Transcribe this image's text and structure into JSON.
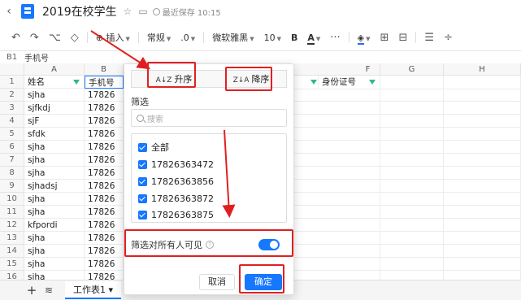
{
  "titlebar": {
    "back": "‹",
    "title": "2019在校学生",
    "star": "☆",
    "folder": "▭",
    "save_status": "最近保存 10:15"
  },
  "toolbar": {
    "undo": "↶",
    "redo": "↷",
    "format_painter": "⌥",
    "eraser": "◇",
    "insert": "插入",
    "number_format": "常规",
    "decimal": ".0",
    "font": "微软雅黑",
    "font_size": "10",
    "bold": "B",
    "font_color": "A",
    "more": "···",
    "fill": "◈",
    "borders": "⊞",
    "merge": "⊟",
    "align": "☰",
    "valign": "÷"
  },
  "formula_bar": {
    "cell_ref": "B1",
    "value": "手机号"
  },
  "columns": [
    "A",
    "B",
    "F",
    "G",
    "H"
  ],
  "rows": [
    {
      "num": "1",
      "a": "姓名",
      "b": "手机号"
    },
    {
      "num": "2",
      "a": "sjha",
      "b": "17826"
    },
    {
      "num": "3",
      "a": "sjfkdj",
      "b": "17826"
    },
    {
      "num": "4",
      "a": "sjF",
      "b": "17826"
    },
    {
      "num": "5",
      "a": "sfdk",
      "b": "17826"
    },
    {
      "num": "6",
      "a": "sjha",
      "b": "17826"
    },
    {
      "num": "7",
      "a": "sjha",
      "b": "17826"
    },
    {
      "num": "8",
      "a": "sjha",
      "b": "17826"
    },
    {
      "num": "9",
      "a": "sjhadsj",
      "b": "17826"
    },
    {
      "num": "10",
      "a": "sjha",
      "b": "17826"
    },
    {
      "num": "11",
      "a": "sjha",
      "b": "17826"
    },
    {
      "num": "12",
      "a": "kfpordi",
      "b": "17826"
    },
    {
      "num": "13",
      "a": "sjha",
      "b": "17826"
    },
    {
      "num": "14",
      "a": "sjha",
      "b": "17826"
    },
    {
      "num": "15",
      "a": "sjha",
      "b": "17826"
    },
    {
      "num": "16",
      "a": "sjha",
      "b": "17826"
    }
  ],
  "header_f": "身份证号",
  "bottom": {
    "add": "+",
    "sheets_icon": "≋",
    "sheet_tab": "工作表1 ▾"
  },
  "filter_panel": {
    "sort_asc": "升序",
    "sort_asc_icon": "A↓Z",
    "sort_desc": "降序",
    "sort_desc_icon": "Z↓A",
    "section_label": "筛选",
    "search_placeholder": "搜索",
    "items": [
      "全部",
      "17826363472",
      "17826363856",
      "17826363872",
      "17826363875"
    ],
    "visible_to_all": "筛选对所有人可见",
    "help": "?",
    "cancel": "取消",
    "confirm": "确定"
  },
  "colors": {
    "accent": "#1677ff",
    "highlight": "#e02020",
    "filter_icon": "#2fb889"
  }
}
